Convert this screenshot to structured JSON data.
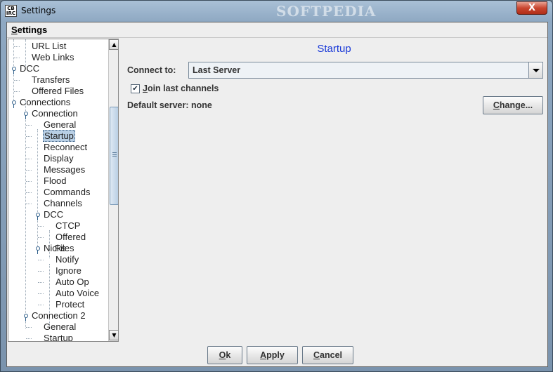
{
  "window": {
    "title": "Settings",
    "app_icon_text": "CB IRC",
    "watermark": "SOFTPEDIA",
    "close_symbol": "X"
  },
  "menubar": {
    "settings_label": "Settings"
  },
  "tree": {
    "items": [
      {
        "label": "URL List"
      },
      {
        "label": "Web Links"
      },
      {
        "label": "DCC"
      },
      {
        "label": "Transfers"
      },
      {
        "label": "Offered Files"
      },
      {
        "label": "Connections"
      },
      {
        "label": "Connection"
      },
      {
        "label": "General"
      },
      {
        "label": "Startup"
      },
      {
        "label": "Reconnect"
      },
      {
        "label": "Display"
      },
      {
        "label": "Messages"
      },
      {
        "label": "Flood"
      },
      {
        "label": "Commands"
      },
      {
        "label": "Channels"
      },
      {
        "label": "DCC"
      },
      {
        "label": "CTCP"
      },
      {
        "label": "Offered Files"
      },
      {
        "label": "Nicks"
      },
      {
        "label": "Notify"
      },
      {
        "label": "Ignore"
      },
      {
        "label": "Auto Op"
      },
      {
        "label": "Auto Voice"
      },
      {
        "label": "Protect"
      },
      {
        "label": "Connection 2"
      },
      {
        "label": "General"
      },
      {
        "label": "Startup"
      }
    ],
    "selected": "Startup"
  },
  "content": {
    "title": "Startup",
    "connect_to_label": "Connect to:",
    "connect_to_value": "Last Server",
    "join_last_channels_label": "Join last channels",
    "join_last_channels_checked": true,
    "check_mark": "✔",
    "default_server_label": "Default server: none",
    "change_button": "Change..."
  },
  "buttons": {
    "ok": "Ok",
    "apply": "Apply",
    "cancel": "Cancel"
  },
  "scrollbar": {
    "up_arrow": "▲",
    "down_arrow": "▼"
  }
}
